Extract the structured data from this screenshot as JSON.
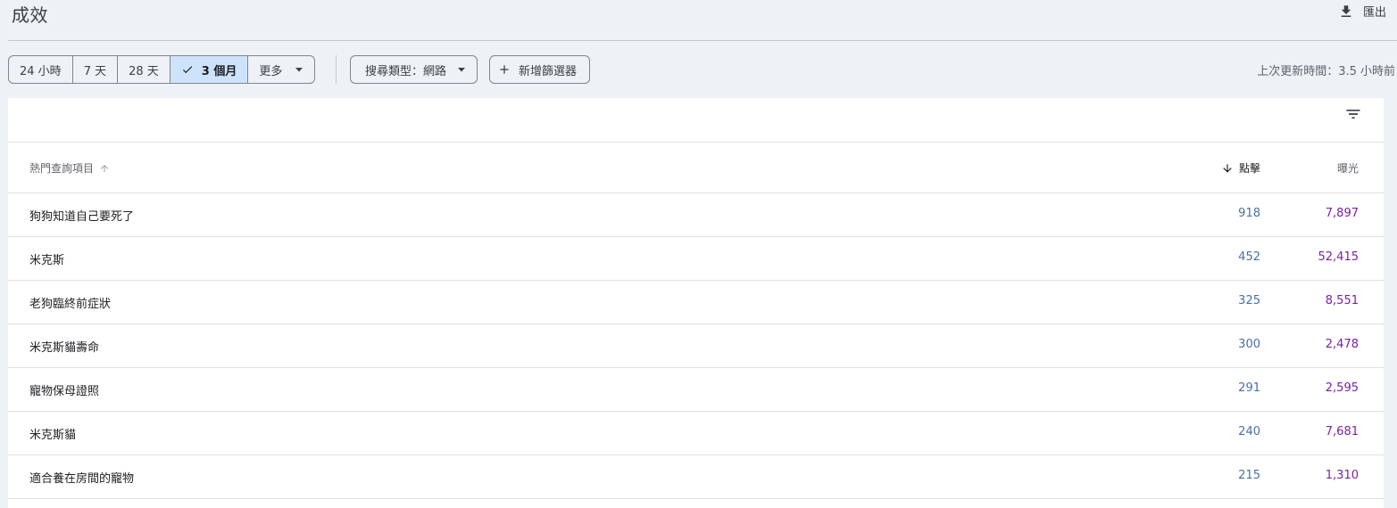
{
  "header": {
    "title": "成效",
    "export_label": "匯出"
  },
  "toolbar": {
    "ranges": [
      {
        "label": "24 小時",
        "active": false
      },
      {
        "label": "7 天",
        "active": false
      },
      {
        "label": "28 天",
        "active": false
      },
      {
        "label": "3 個月",
        "active": true
      },
      {
        "label": "更多",
        "active": false
      }
    ],
    "search_type_label": "搜尋類型：網路",
    "add_filter_label": "新增篩選器",
    "last_updated": "上次更新時間：3.5 小時前"
  },
  "table": {
    "columns": {
      "query": "熱門查詢項目",
      "clicks": "點擊",
      "impressions": "曝光"
    },
    "rows": [
      {
        "query": "狗狗知道自己要死了",
        "clicks": "918",
        "impressions": "7,897"
      },
      {
        "query": "米克斯",
        "clicks": "452",
        "impressions": "52,415"
      },
      {
        "query": "老狗臨終前症狀",
        "clicks": "325",
        "impressions": "8,551"
      },
      {
        "query": "米克斯貓壽命",
        "clicks": "300",
        "impressions": "2,478"
      },
      {
        "query": "寵物保母證照",
        "clicks": "291",
        "impressions": "2,595"
      },
      {
        "query": "米克斯貓",
        "clicks": "240",
        "impressions": "7,681"
      },
      {
        "query": "適合養在房間的寵物",
        "clicks": "215",
        "impressions": "1,310"
      }
    ]
  },
  "colors": {
    "clicks": "#4a6fa5",
    "impressions": "#7b1fa2",
    "active_segment": "#cde3fb",
    "background": "#eef1f6"
  },
  "icons": [
    "download-icon",
    "check-icon",
    "caret-down-icon",
    "plus-icon",
    "filter-icon",
    "sort-up-arrow-icon",
    "sort-down-arrow-icon"
  ]
}
